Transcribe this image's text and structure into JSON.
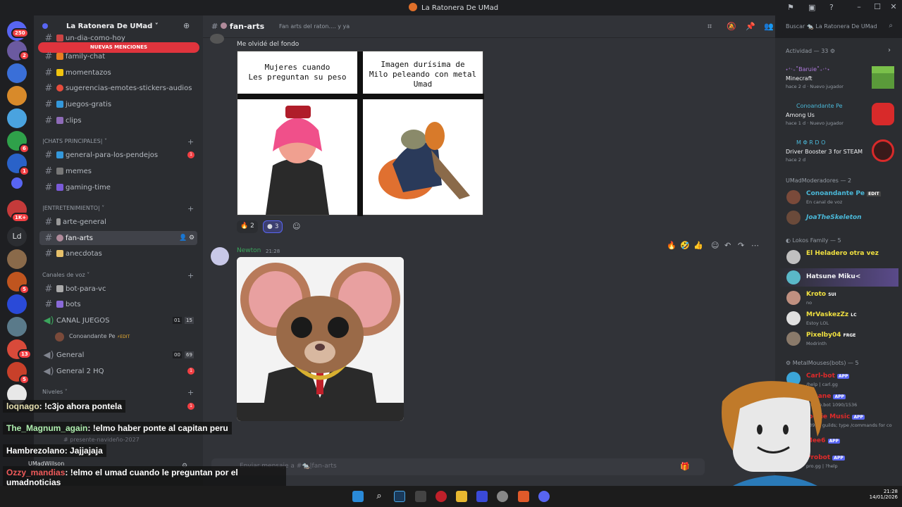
{
  "window": {
    "title": "La Ratonera De UMad"
  },
  "server": {
    "name": "La Ratonera De UMad",
    "new_mentions": "NUEVAS MENCIONES",
    "badges": {
      "home": "250",
      "s2": "2",
      "s9": "6",
      "s10": "1",
      "s12": "1K+",
      "s13": "5",
      "s17": "13",
      "s18": "5"
    }
  },
  "channels": {
    "top": [
      {
        "name": "un-dia-como-hoy",
        "unread": ""
      },
      {
        "name": "family-chat",
        "unread": ""
      },
      {
        "name": "momentazos",
        "unread": ""
      },
      {
        "name": "sugerencias-emotes-stickers-audios",
        "unread": ""
      },
      {
        "name": "juegos-gratis",
        "unread": ""
      },
      {
        "name": "clips",
        "unread": ""
      }
    ],
    "cat_chats": "CHATS PRINCIPALES",
    "chats": [
      {
        "name": "general-para-los-pendejos",
        "unread": "1"
      },
      {
        "name": "memes",
        "unread": ""
      },
      {
        "name": "gaming-time",
        "unread": ""
      }
    ],
    "cat_ent": "ENTRETENIMIENTO",
    "ent": [
      {
        "name": "arte-general"
      },
      {
        "name": "fan-arts"
      },
      {
        "name": "anecdotas"
      }
    ],
    "cat_voice": "Canales de voz",
    "voice_text": [
      {
        "name": "bot-para-vc"
      },
      {
        "name": "bots"
      }
    ],
    "voice": [
      {
        "name": "CANAL JUEGOS",
        "c1": "01",
        "c2": "15"
      },
      {
        "name": "General",
        "c1": "00",
        "c2": "69"
      },
      {
        "name": "General 2 HQ",
        "c1": "",
        "c2": ""
      }
    ],
    "voice_user": "Conoandante Pe",
    "voice_user_tag": "EDIT",
    "cat_levels": "Niveles",
    "presente": "presente-navideño-2027",
    "user": "UMadWillson",
    "general2_unread": "1",
    "levels_unread": "1"
  },
  "header": {
    "channel": "fan-arts",
    "topic": "Fan arts del raton.... y ya",
    "search": "Buscar 🐀 La Ratonera De UMad"
  },
  "messages": {
    "prev_text": "Me olvidé del fondo",
    "meme_left": "Mujeres cuando\nLes preguntan su peso",
    "meme_right": "Imagen durísima de\nMilo peleando con metal\nUmad",
    "react1_count": "2",
    "react2_count": "3",
    "author": "Newton",
    "time": "21:28",
    "chat_placeholder": "Enviar mensaje a #🐀|fan-arts"
  },
  "members": {
    "activity_header": "Actividad — 33",
    "activities": [
      {
        "user": "˖⁺‧₊˚Baruie˚₊‧⁺˖",
        "game": "Minecraft",
        "meta": "hace 2 d",
        "tag": "Nuevo jugador"
      },
      {
        "user": "Conoandante Pe",
        "game": "Among Us",
        "meta": "hace 1 d",
        "tag": "Nuevo jugador"
      },
      {
        "user": "M Φ R D O",
        "game": "Driver Booster 3 for STEAM",
        "meta": "hace 2 d",
        "tag": ""
      }
    ],
    "mods_header": "UMadModeradores — 2",
    "mods": [
      {
        "name": "Conoandante Pe",
        "tag": "EDIT",
        "sub": "En canal de voz"
      },
      {
        "name": "JoaTheSkeleton",
        "tag": "",
        "sub": ""
      }
    ],
    "lokos_header": "Lokos Family — 5",
    "lokos": [
      {
        "name": "El Heladero otra vez",
        "tag": "",
        "sub": ""
      },
      {
        "name": "Hatsune Miku<",
        "tag": "",
        "sub": ""
      },
      {
        "name": "Kroto",
        "tag": "SUI",
        "sub": "no"
      },
      {
        "name": "MrVaskezZz",
        "tag": "LC",
        "sub": "Estoy LOL"
      },
      {
        "name": "Pixelby04",
        "tag": "FRGE",
        "sub": "Modrinth"
      }
    ],
    "bots_header": "MetalMouses(bots) — 5",
    "bots": [
      {
        "name": "Carl-bot",
        "tag": "APP",
        "sub": "/help | carl.gg"
      },
      {
        "name": "Arcane",
        "tag": "APP",
        "sub": "arcane.bot 1090/1536"
      },
      {
        "name": "Jockie Music",
        "tag": "APP",
        "sub": "53995 guilds; type /commands for co"
      },
      {
        "name": "Mee6",
        "tag": "APP",
        "sub": ""
      },
      {
        "name": "Probot",
        "tag": "APP",
        "sub": "pro.gg | ?help"
      }
    ]
  },
  "stream_chat": [
    {
      "user": "loqnago",
      "text": "!c3jo ahora pontela"
    },
    {
      "user": "The_Magnum_again",
      "text": "!elmo haber ponte al capitan peru"
    },
    {
      "user": "Hambrezolano",
      "text": "Jajjajaja"
    },
    {
      "user": "Ozzy_mandias",
      "text": "!elmo el umad cuando le preguntan por el umadnoticias"
    }
  ],
  "clock": {
    "time": "21:28",
    "date": "14/01/2026"
  },
  "colors": {
    "accent": "#5865f2",
    "danger": "#f23f43",
    "bg": "#313338"
  }
}
